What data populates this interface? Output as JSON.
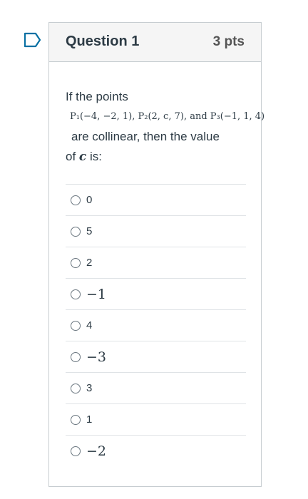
{
  "question": {
    "title": "Question 1",
    "points": "3 pts",
    "text_line1": "If the points",
    "math_line": "P₁(−4, −2, 1), P₂(2, c, 7), and P₃(−1, 1, 4)",
    "text_line2": "are collinear, then the value",
    "text_line3_pre": "of ",
    "text_line3_var": "c",
    "text_line3_post": " is:"
  },
  "options": [
    {
      "label": "0"
    },
    {
      "label": "5"
    },
    {
      "label": "2"
    },
    {
      "label": "−1"
    },
    {
      "label": "4"
    },
    {
      "label": "−3"
    },
    {
      "label": "3"
    },
    {
      "label": "1"
    },
    {
      "label": "−2"
    }
  ],
  "colors": {
    "border": "#c7cdd1",
    "header_bg": "#f5f5f5",
    "flag": "#0770a3",
    "text": "#2d3b45"
  },
  "icons": {
    "flag": "bookmark-flag-icon",
    "radio": "radio-unchecked-icon"
  }
}
